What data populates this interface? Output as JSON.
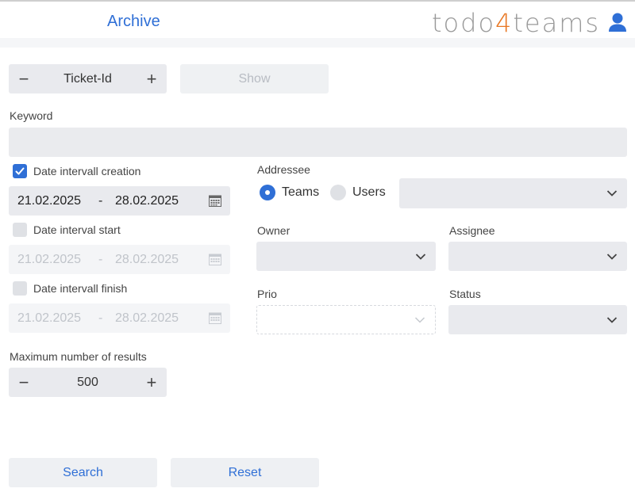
{
  "header": {
    "title": "Archive",
    "brand_prefix": "todo",
    "brand_digit": "4",
    "brand_suffix": "teams"
  },
  "colors": {
    "accent": "#2f6fd6",
    "brand_digit": "#e87722",
    "field_bg": "#e9eaee"
  },
  "ticket_stepper": {
    "minus": "−",
    "label": "Ticket-Id",
    "plus": "+"
  },
  "show_button": "Show",
  "keyword": {
    "label": "Keyword",
    "value": ""
  },
  "date_creation": {
    "label": "Date intervall creation",
    "checked": true,
    "from": "21.02.2025",
    "sep": "-",
    "to": "28.02.2025"
  },
  "date_start": {
    "label": "Date interval start",
    "checked": false,
    "from": "21.02.2025",
    "sep": "-",
    "to": "28.02.2025"
  },
  "date_finish": {
    "label": "Date intervall finish",
    "checked": false,
    "from": "21.02.2025",
    "sep": "-",
    "to": "28.02.2025"
  },
  "max_results": {
    "label": "Maximum number of results",
    "minus": "−",
    "value": "500",
    "plus": "+"
  },
  "addressee": {
    "label": "Addressee",
    "options": [
      "Teams",
      "Users"
    ],
    "selected": "Teams",
    "value": ""
  },
  "owner": {
    "label": "Owner",
    "value": ""
  },
  "assignee": {
    "label": "Assignee",
    "value": ""
  },
  "prio": {
    "label": "Prio",
    "value": ""
  },
  "status": {
    "label": "Status",
    "value": ""
  },
  "actions": {
    "search": "Search",
    "reset": "Reset"
  },
  "icons": [
    "user-icon",
    "calendar-icon",
    "chevron-down-icon",
    "check-icon"
  ]
}
